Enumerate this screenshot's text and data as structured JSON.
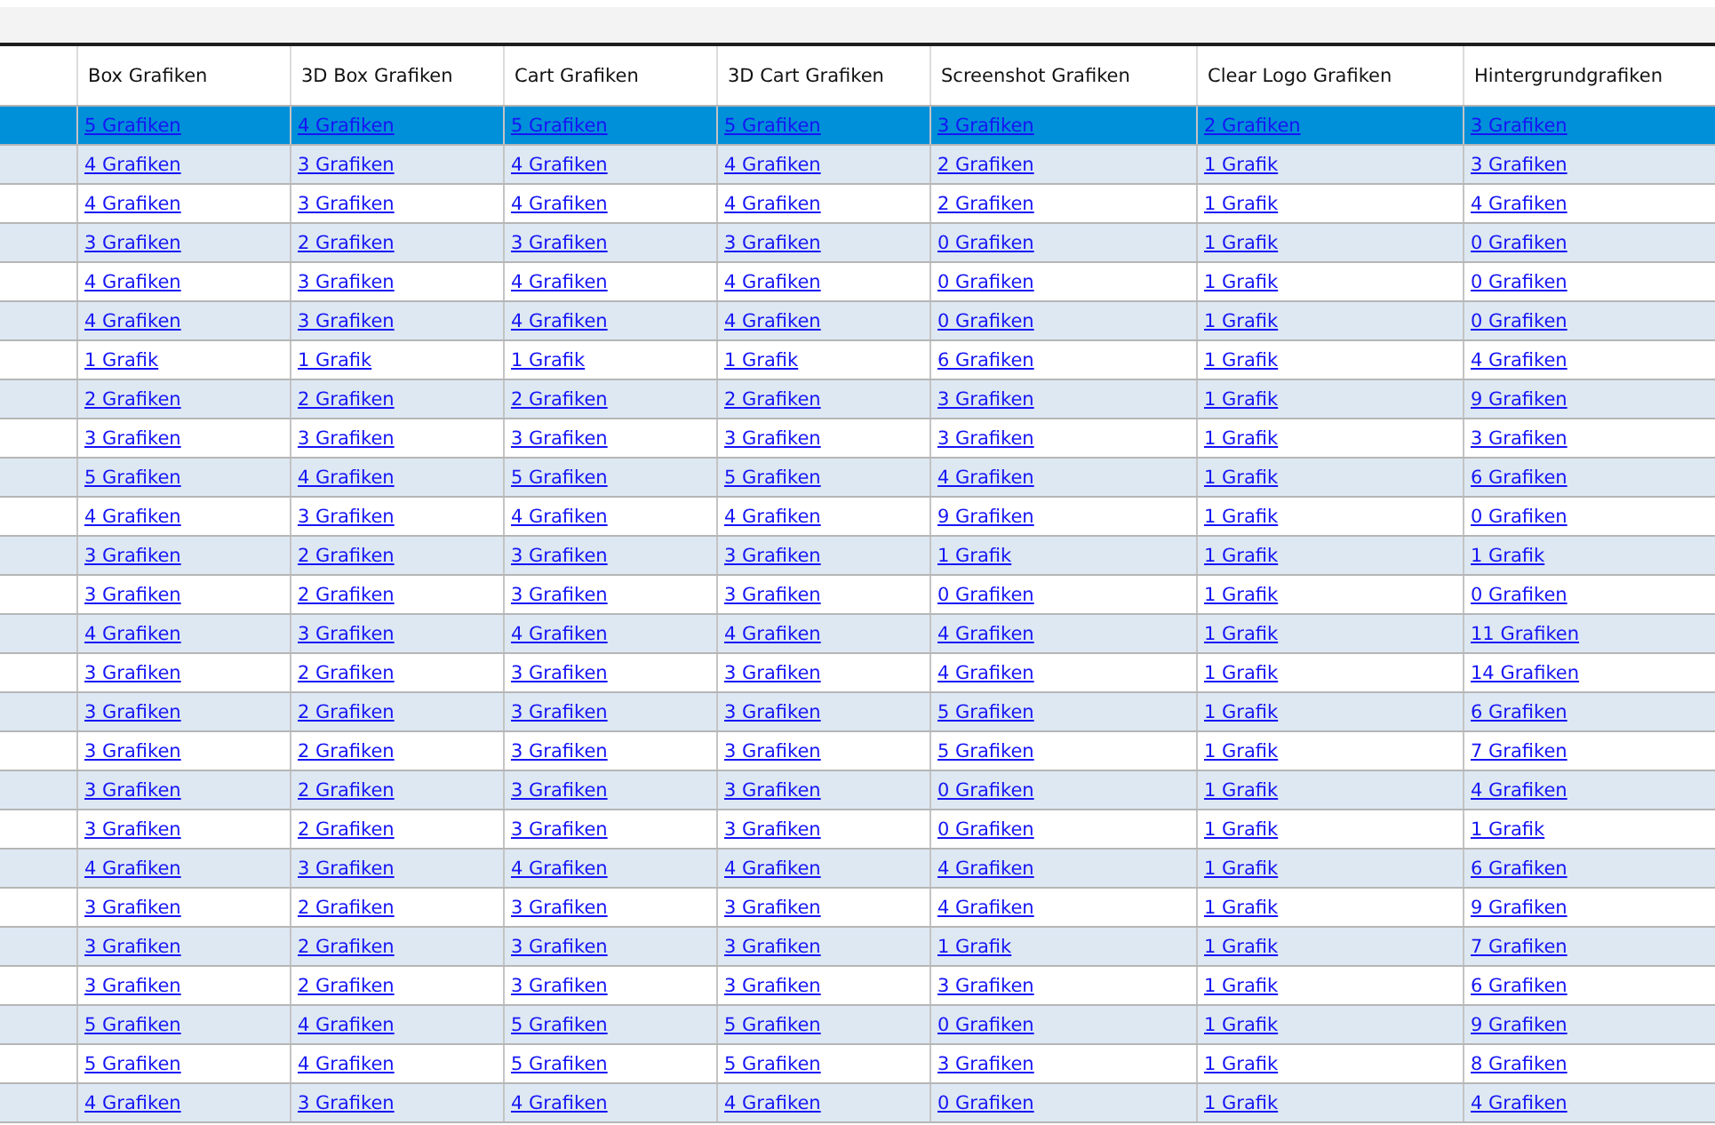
{
  "table": {
    "columns": [
      "Box Grafiken",
      "3D Box Grafiken",
      "Cart Grafiken",
      "3D Cart Grafiken",
      "Screenshot Grafiken",
      "Clear Logo Grafiken",
      "Hintergrundgrafiken"
    ],
    "rows": [
      {
        "selected": true,
        "cells": [
          "5 Grafiken",
          "4 Grafiken",
          "5 Grafiken",
          "5 Grafiken",
          "3 Grafiken",
          "2 Grafiken",
          "3 Grafiken"
        ]
      },
      {
        "selected": false,
        "cells": [
          "4 Grafiken",
          "3 Grafiken",
          "4 Grafiken",
          "4 Grafiken",
          "2 Grafiken",
          "1 Grafik",
          "3 Grafiken"
        ]
      },
      {
        "selected": false,
        "cells": [
          "4 Grafiken",
          "3 Grafiken",
          "4 Grafiken",
          "4 Grafiken",
          "2 Grafiken",
          "1 Grafik",
          "4 Grafiken"
        ]
      },
      {
        "selected": false,
        "cells": [
          "3 Grafiken",
          "2 Grafiken",
          "3 Grafiken",
          "3 Grafiken",
          "0 Grafiken",
          "1 Grafik",
          "0 Grafiken"
        ]
      },
      {
        "selected": false,
        "cells": [
          "4 Grafiken",
          "3 Grafiken",
          "4 Grafiken",
          "4 Grafiken",
          "0 Grafiken",
          "1 Grafik",
          "0 Grafiken"
        ]
      },
      {
        "selected": false,
        "cells": [
          "4 Grafiken",
          "3 Grafiken",
          "4 Grafiken",
          "4 Grafiken",
          "0 Grafiken",
          "1 Grafik",
          "0 Grafiken"
        ]
      },
      {
        "selected": false,
        "cells": [
          "1 Grafik",
          "1 Grafik",
          "1 Grafik",
          "1 Grafik",
          "6 Grafiken",
          "1 Grafik",
          "4 Grafiken"
        ]
      },
      {
        "selected": false,
        "cells": [
          "2 Grafiken",
          "2 Grafiken",
          "2 Grafiken",
          "2 Grafiken",
          "3 Grafiken",
          "1 Grafik",
          "9 Grafiken"
        ]
      },
      {
        "selected": false,
        "cells": [
          "3 Grafiken",
          "3 Grafiken",
          "3 Grafiken",
          "3 Grafiken",
          "3 Grafiken",
          "1 Grafik",
          "3 Grafiken"
        ]
      },
      {
        "selected": false,
        "cells": [
          "5 Grafiken",
          "4 Grafiken",
          "5 Grafiken",
          "5 Grafiken",
          "4 Grafiken",
          "1 Grafik",
          "6 Grafiken"
        ]
      },
      {
        "selected": false,
        "cells": [
          "4 Grafiken",
          "3 Grafiken",
          "4 Grafiken",
          "4 Grafiken",
          "9 Grafiken",
          "1 Grafik",
          "0 Grafiken"
        ]
      },
      {
        "selected": false,
        "cells": [
          "3 Grafiken",
          "2 Grafiken",
          "3 Grafiken",
          "3 Grafiken",
          "1 Grafik",
          "1 Grafik",
          "1 Grafik"
        ]
      },
      {
        "selected": false,
        "cells": [
          "3 Grafiken",
          "2 Grafiken",
          "3 Grafiken",
          "3 Grafiken",
          "0 Grafiken",
          "1 Grafik",
          "0 Grafiken"
        ]
      },
      {
        "selected": false,
        "cells": [
          "4 Grafiken",
          "3 Grafiken",
          "4 Grafiken",
          "4 Grafiken",
          "4 Grafiken",
          "1 Grafik",
          "11 Grafiken"
        ]
      },
      {
        "selected": false,
        "cells": [
          "3 Grafiken",
          "2 Grafiken",
          "3 Grafiken",
          "3 Grafiken",
          "4 Grafiken",
          "1 Grafik",
          "14 Grafiken"
        ]
      },
      {
        "selected": false,
        "cells": [
          "3 Grafiken",
          "2 Grafiken",
          "3 Grafiken",
          "3 Grafiken",
          "5 Grafiken",
          "1 Grafik",
          "6 Grafiken"
        ]
      },
      {
        "selected": false,
        "cells": [
          "3 Grafiken",
          "2 Grafiken",
          "3 Grafiken",
          "3 Grafiken",
          "5 Grafiken",
          "1 Grafik",
          "7 Grafiken"
        ]
      },
      {
        "selected": false,
        "cells": [
          "3 Grafiken",
          "2 Grafiken",
          "3 Grafiken",
          "3 Grafiken",
          "0 Grafiken",
          "1 Grafik",
          "4 Grafiken"
        ]
      },
      {
        "selected": false,
        "cells": [
          "3 Grafiken",
          "2 Grafiken",
          "3 Grafiken",
          "3 Grafiken",
          "0 Grafiken",
          "1 Grafik",
          "1 Grafik"
        ]
      },
      {
        "selected": false,
        "cells": [
          "4 Grafiken",
          "3 Grafiken",
          "4 Grafiken",
          "4 Grafiken",
          "4 Grafiken",
          "1 Grafik",
          "6 Grafiken"
        ]
      },
      {
        "selected": false,
        "cells": [
          "3 Grafiken",
          "2 Grafiken",
          "3 Grafiken",
          "3 Grafiken",
          "4 Grafiken",
          "1 Grafik",
          "9 Grafiken"
        ]
      },
      {
        "selected": false,
        "cells": [
          "3 Grafiken",
          "2 Grafiken",
          "3 Grafiken",
          "3 Grafiken",
          "1 Grafik",
          "1 Grafik",
          "7 Grafiken"
        ]
      },
      {
        "selected": false,
        "cells": [
          "3 Grafiken",
          "2 Grafiken",
          "3 Grafiken",
          "3 Grafiken",
          "3 Grafiken",
          "1 Grafik",
          "6 Grafiken"
        ]
      },
      {
        "selected": false,
        "cells": [
          "5 Grafiken",
          "4 Grafiken",
          "5 Grafiken",
          "5 Grafiken",
          "0 Grafiken",
          "1 Grafik",
          "9 Grafiken"
        ]
      },
      {
        "selected": false,
        "cells": [
          "5 Grafiken",
          "4 Grafiken",
          "5 Grafiken",
          "5 Grafiken",
          "3 Grafiken",
          "1 Grafik",
          "8 Grafiken"
        ]
      },
      {
        "selected": false,
        "cells": [
          "4 Grafiken",
          "3 Grafiken",
          "4 Grafiken",
          "4 Grafiken",
          "0 Grafiken",
          "1 Grafik",
          "4 Grafiken"
        ]
      }
    ]
  }
}
